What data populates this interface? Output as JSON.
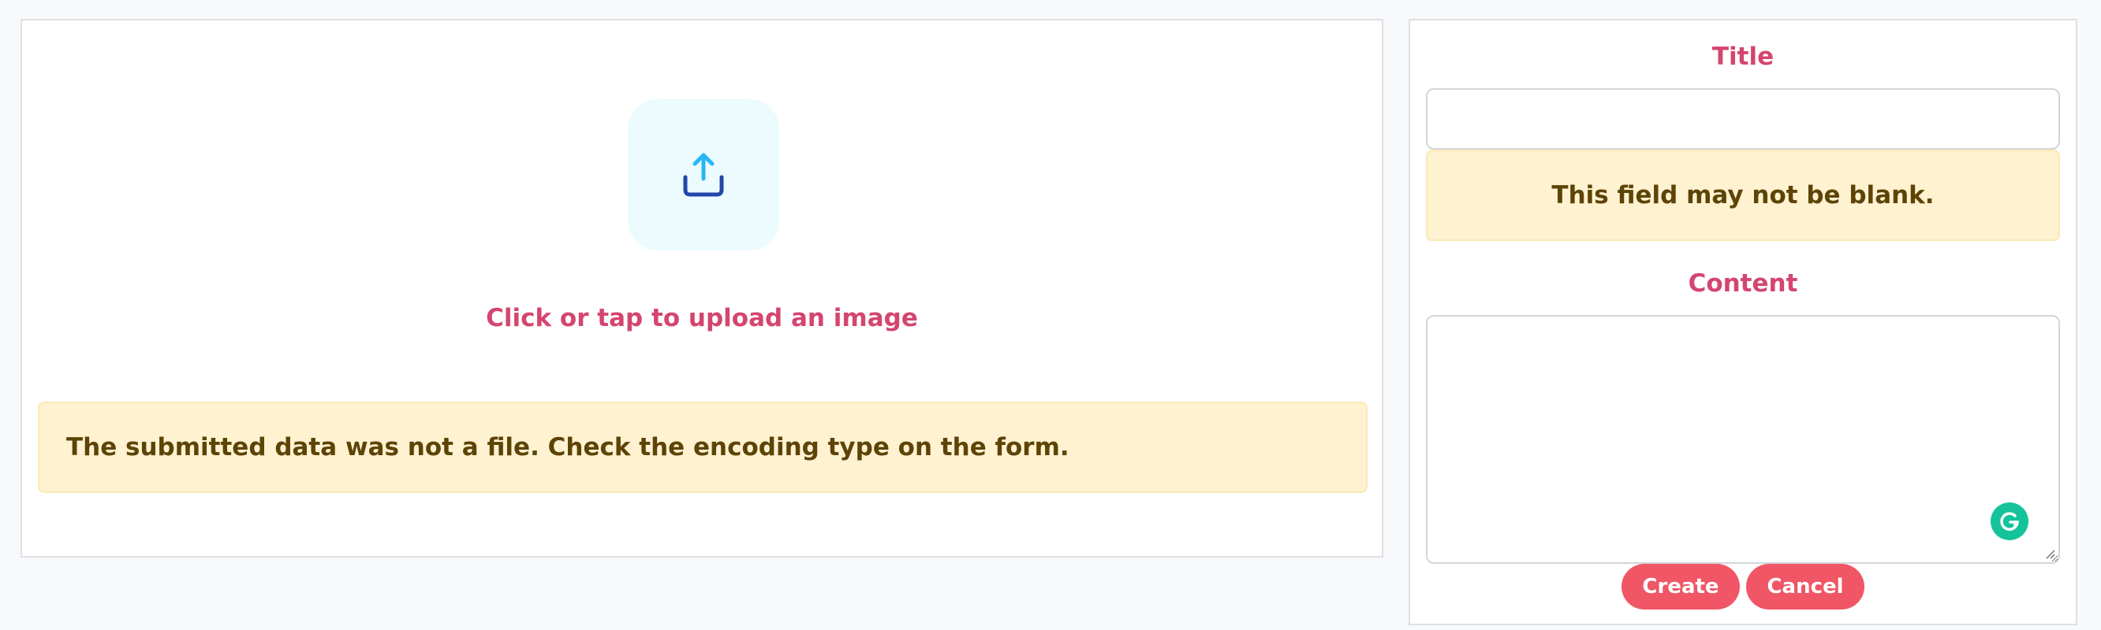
{
  "upload": {
    "icon": "upload-icon",
    "caption": "Click or tap to upload an image",
    "error": "The submitted data was not a file. Check the encoding type on the form."
  },
  "form": {
    "title_label": "Title",
    "title_value": "",
    "title_error": "This field may not be blank.",
    "content_label": "Content",
    "content_value": "",
    "create_label": "Create",
    "cancel_label": "Cancel"
  },
  "colors": {
    "label_pink": "#d4456f",
    "alert_bg": "#fff2d1",
    "alert_text": "#5d4306",
    "button_red": "#ef4859",
    "upload_tile_bg": "#ebfbfe",
    "grammarly_green": "#15c39a"
  }
}
